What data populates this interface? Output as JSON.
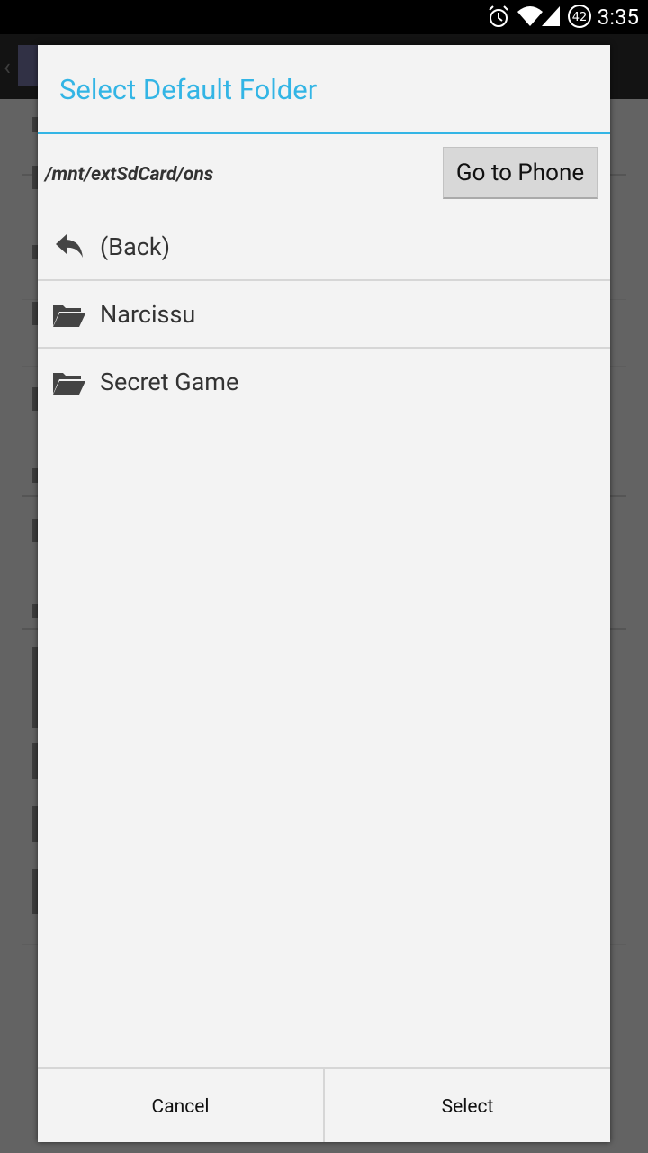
{
  "status_bar": {
    "time": "3:35",
    "battery_level": "42",
    "icons": [
      "alarm-icon",
      "wifi-icon",
      "signal-icon",
      "battery-icon"
    ]
  },
  "dialog": {
    "title": "Select Default Folder",
    "current_path": "/mnt/extSdCard/ons",
    "go_to_phone_label": "Go to Phone",
    "items": [
      {
        "label": "(Back)",
        "icon": "back-arrow-icon"
      },
      {
        "label": "Narcissu",
        "icon": "folder-icon"
      },
      {
        "label": "Secret Game",
        "icon": "folder-icon"
      }
    ],
    "buttons": {
      "cancel": "Cancel",
      "select": "Select"
    }
  },
  "colors": {
    "accent": "#33b5e5",
    "dialog_background": "#f3f3f3",
    "status_bar": "#000000"
  }
}
